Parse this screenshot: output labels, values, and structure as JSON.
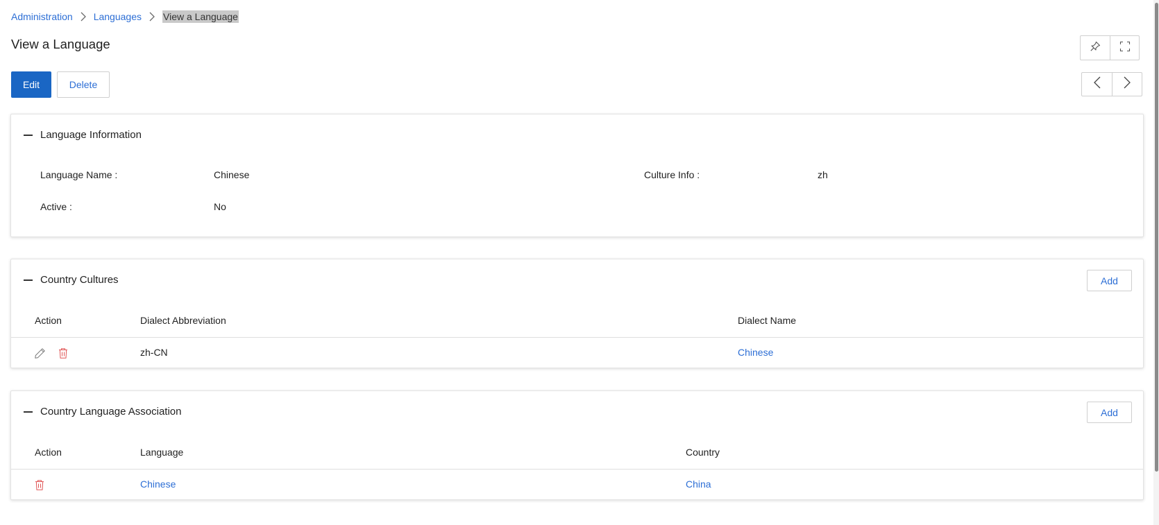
{
  "breadcrumb": {
    "items": [
      "Administration",
      "Languages"
    ],
    "current": "View a Language"
  },
  "page": {
    "title": "View a Language"
  },
  "toolbar": {
    "edit_label": "Edit",
    "delete_label": "Delete",
    "icons": [
      "pin-icon",
      "fullscreen-icon",
      "chevron-left-icon",
      "chevron-right-icon"
    ]
  },
  "language_info": {
    "title": "Language Information",
    "fields": [
      {
        "label": "Language Name :",
        "value": "Chinese"
      },
      {
        "label": "Culture Info :",
        "value": "zh"
      },
      {
        "label": "Active :",
        "value": "No"
      }
    ]
  },
  "country_cultures": {
    "title": "Country Cultures",
    "add_label": "Add",
    "columns": [
      "Action",
      "Dialect Abbreviation",
      "Dialect Name"
    ],
    "rows": [
      {
        "abbreviation": "zh-CN",
        "dialect_name": "Chinese"
      }
    ]
  },
  "country_language_association": {
    "title": "Country Language Association",
    "add_label": "Add",
    "columns": [
      "Action",
      "Language",
      "Country"
    ],
    "rows": [
      {
        "language": "Chinese",
        "country": "China"
      }
    ]
  },
  "colors": {
    "primary": "#1a66c4",
    "link": "#2c6ed5",
    "delete_icon": "#e05555"
  }
}
